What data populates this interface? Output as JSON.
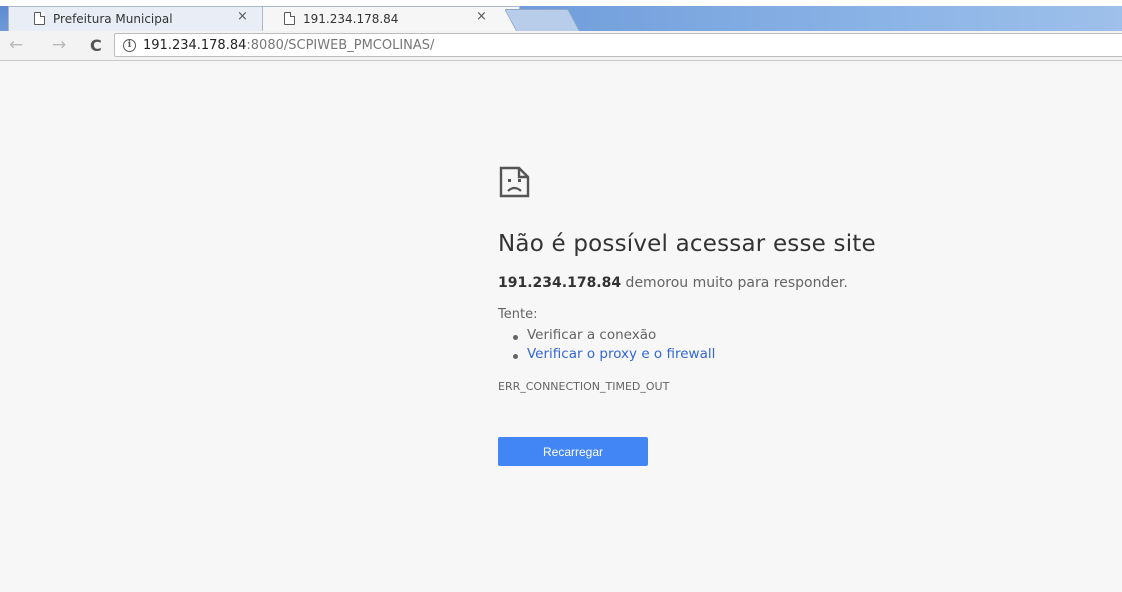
{
  "tabs": [
    {
      "title": "Prefeitura Municipal",
      "close": "×"
    },
    {
      "title": "191.234.178.84",
      "close": "×"
    }
  ],
  "toolbar": {
    "back_icon": "←",
    "forward_icon": "→",
    "reload_icon": "C",
    "info_icon": "i",
    "url_host": "191.234.178.84",
    "url_rest": ":8080/SCPIWEB_PMCOLINAS/"
  },
  "error": {
    "title": "Não é possível acessar esse site",
    "host": "191.234.178.84",
    "message": " demorou muito para responder.",
    "try_label": "Tente:",
    "suggestions": [
      "Verificar a conexão",
      "Verificar o proxy e o firewall"
    ],
    "code": "ERR_CONNECTION_TIMED_OUT",
    "reload_label": "Recarregar"
  },
  "colors": {
    "accent": "#4285f4",
    "link": "#3367d6",
    "background": "#f7f7f7"
  }
}
